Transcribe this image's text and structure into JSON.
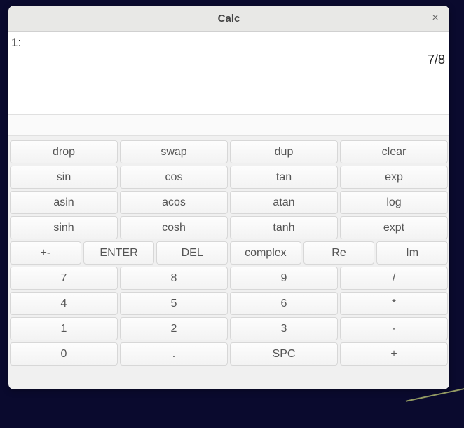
{
  "window": {
    "title": "Calc",
    "close_glyph": "×"
  },
  "stack": {
    "label": "1:",
    "value": "7/8"
  },
  "input": {
    "value": ""
  },
  "rows": {
    "r0": {
      "c0": "drop",
      "c1": "swap",
      "c2": "dup",
      "c3": "clear"
    },
    "r1": {
      "c0": "sin",
      "c1": "cos",
      "c2": "tan",
      "c3": "exp"
    },
    "r2": {
      "c0": "asin",
      "c1": "acos",
      "c2": "atan",
      "c3": "log"
    },
    "r3": {
      "c0": "sinh",
      "c1": "cosh",
      "c2": "tanh",
      "c3": "expt"
    },
    "r4": {
      "c0": "+-",
      "c1": "ENTER",
      "c2": "DEL",
      "c3": "complex",
      "c4": "Re",
      "c5": "Im"
    },
    "r5": {
      "c0": "7",
      "c1": "8",
      "c2": "9",
      "c3": "/"
    },
    "r6": {
      "c0": "4",
      "c1": "5",
      "c2": "6",
      "c3": "*"
    },
    "r7": {
      "c0": "1",
      "c1": "2",
      "c2": "3",
      "c3": "-"
    },
    "r8": {
      "c0": "0",
      "c1": ".",
      "c2": "SPC",
      "c3": "+"
    }
  }
}
